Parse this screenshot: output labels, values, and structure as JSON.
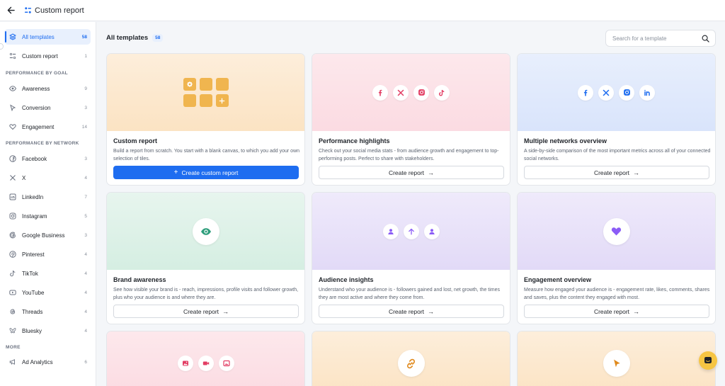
{
  "header": {
    "title": "Custom report",
    "back_icon": "arrow-left-icon",
    "title_icon": "custom-report-icon"
  },
  "sidebar": {
    "items_top": [
      {
        "label": "All templates",
        "count": "58",
        "icon": "layers-icon",
        "active": true
      },
      {
        "label": "Custom report",
        "count": "1",
        "icon": "custom-report-icon",
        "active": false
      }
    ],
    "sections": [
      {
        "title": "PERFORMANCE BY GOAL",
        "items": [
          {
            "label": "Awareness",
            "count": "9",
            "icon": "eye-icon"
          },
          {
            "label": "Conversion",
            "count": "3",
            "icon": "cursor-icon"
          },
          {
            "label": "Engagement",
            "count": "14",
            "icon": "heart-icon"
          }
        ]
      },
      {
        "title": "PERFORMANCE BY NETWORK",
        "items": [
          {
            "label": "Facebook",
            "count": "3",
            "icon": "facebook-icon"
          },
          {
            "label": "X",
            "count": "4",
            "icon": "x-icon"
          },
          {
            "label": "LinkedIn",
            "count": "7",
            "icon": "linkedin-icon"
          },
          {
            "label": "Instagram",
            "count": "5",
            "icon": "instagram-icon"
          },
          {
            "label": "Google Business",
            "count": "3",
            "icon": "google-icon"
          },
          {
            "label": "Pinterest",
            "count": "4",
            "icon": "pinterest-icon"
          },
          {
            "label": "TikTok",
            "count": "4",
            "icon": "tiktok-icon"
          },
          {
            "label": "YouTube",
            "count": "4",
            "icon": "youtube-icon"
          },
          {
            "label": "Threads",
            "count": "4",
            "icon": "threads-icon"
          },
          {
            "label": "Bluesky",
            "count": "4",
            "icon": "bluesky-icon"
          }
        ]
      },
      {
        "title": "MORE",
        "items": [
          {
            "label": "Ad Analytics",
            "count": "6",
            "icon": "megaphone-icon"
          }
        ]
      }
    ]
  },
  "main": {
    "title": "All templates",
    "count": "58",
    "search_placeholder": "Search for a template"
  },
  "cards": [
    {
      "title": "Custom report",
      "description": "Build a report from scratch. You start with a blank canvas, to which you add your own selection of tiles.",
      "button": "Create custom report",
      "primary": true
    },
    {
      "title": "Performance highlights",
      "description": "Check out your social media stats - from audience growth and engagement to top-performing posts. Perfect to share with stakeholders.",
      "button": "Create report"
    },
    {
      "title": "Multiple networks overview",
      "description": "A side-by-side comparison of the most important metrics across all of your connected social networks.",
      "button": "Create report"
    },
    {
      "title": "Brand awareness",
      "description": "See how visible your brand is - reach, impressions, profile visits and follower growth, plus who your audience is and where they are.",
      "button": "Create report"
    },
    {
      "title": "Audience insights",
      "description": "Understand who your audience is - followers gained and lost, net growth, the times they are most active and where they come from.",
      "button": "Create report"
    },
    {
      "title": "Engagement overview",
      "description": "Measure how engaged your audience is - engagement rate, likes, comments, shares and saves, plus the content they engaged with most.",
      "button": "Create report"
    }
  ],
  "colors": {
    "accent": "#1e6df0",
    "tile": "#f0b54f",
    "pink_icon": "#e23d63",
    "blue_icon": "#1e6df0",
    "green_icon": "#2f9e7c",
    "purple_icon": "#8b5cf6",
    "orange_icon": "#e08a1e",
    "chat": "#f6c543"
  },
  "chat_icon": "chat-icon"
}
